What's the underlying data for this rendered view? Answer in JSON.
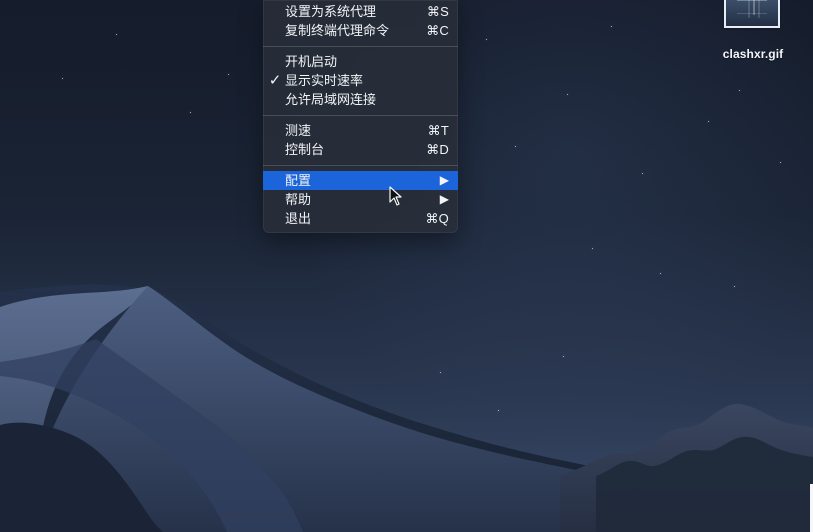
{
  "desktop": {
    "file": {
      "name": "clashxr.gif"
    }
  },
  "menu": {
    "items": [
      {
        "label": "设置为系统代理",
        "shortcut": "⌘S"
      },
      {
        "label": "复制终端代理命令",
        "shortcut": "⌘C"
      },
      {
        "label": "开机启动"
      },
      {
        "label": "显示实时速率",
        "checked": true
      },
      {
        "label": "允许局域网连接"
      },
      {
        "label": "测速",
        "shortcut": "⌘T"
      },
      {
        "label": "控制台",
        "shortcut": "⌘D"
      },
      {
        "label": "配置",
        "submenu": true,
        "selected": true
      },
      {
        "label": "帮助",
        "submenu": true
      },
      {
        "label": "退出",
        "shortcut": "⌘Q"
      }
    ]
  },
  "symbols": {
    "checkmark": "✓",
    "submenu_arrow": "▶"
  },
  "icons": {
    "submenu_arrow": "triangle-right-icon",
    "cursor": "pointer-cursor-icon",
    "file": "gif-file-icon"
  },
  "colors": {
    "menu_highlight": "#1b64da",
    "menu_text": "#f2f4f7",
    "desktop_sky_top": "#151c2b",
    "desktop_sky_bottom": "#3a4b6a",
    "dune_dark": "#1b2436",
    "dune_light": "#495b7d"
  }
}
